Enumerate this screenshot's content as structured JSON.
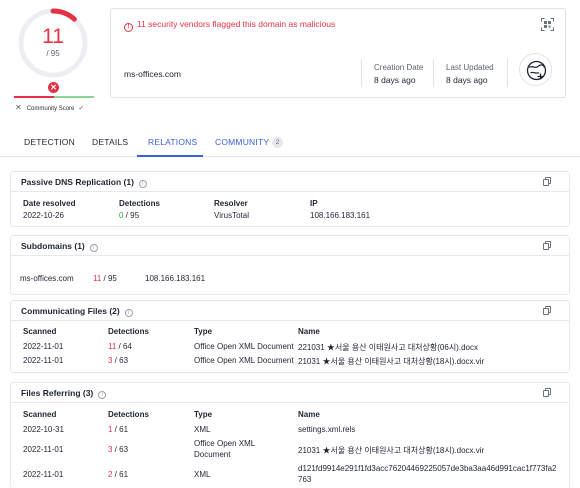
{
  "score": {
    "positives": "11",
    "total": "/ 95",
    "progress_fraction": 0.116
  },
  "community": {
    "label": "Community Score"
  },
  "summary": {
    "alert": "11 security vendors flagged this domain as malicious",
    "domain": "ms-offices.com",
    "creation_label": "Creation Date",
    "creation_value": "8 days ago",
    "updated_label": "Last Updated",
    "updated_value": "8 days ago"
  },
  "tabs": {
    "detection": "DETECTION",
    "details": "DETAILS",
    "relations": "RELATIONS",
    "community": "COMMUNITY",
    "community_count": "2"
  },
  "passive_dns": {
    "title": "Passive DNS Replication (1)",
    "headers": [
      "Date resolved",
      "Detections",
      "Resolver",
      "IP"
    ],
    "rows": [
      {
        "date": "2022-10-26",
        "det_pos": "0",
        "det_total": " / 95",
        "resolver": "VirusTotal",
        "ip": "108.166.183.161"
      }
    ]
  },
  "subdomains": {
    "title": "Subdomains (1)",
    "rows": [
      {
        "name": "ms-offices.com",
        "det_pos": "11",
        "det_total": " / 95",
        "ip": "108.166.183.161"
      }
    ]
  },
  "communicating": {
    "title": "Communicating Files (2)",
    "headers": [
      "Scanned",
      "Detections",
      "Type",
      "Name"
    ],
    "rows": [
      {
        "scanned": "2022-11-01",
        "det_pos": "11",
        "det_total": " / 64",
        "type": "Office Open XML Document",
        "name": "221031 ★서울 용산 이태원사고 대처상황(06시).docx"
      },
      {
        "scanned": "2022-11-01",
        "det_pos": "3",
        "det_total": " / 63",
        "type": "Office Open XML Document",
        "name": "21031 ★서울 용산 이태원사고 대처상황(18시).docx.vir"
      }
    ]
  },
  "referring": {
    "title": "Files Referring (3)",
    "headers": [
      "Scanned",
      "Detections",
      "Type",
      "Name"
    ],
    "rows": [
      {
        "scanned": "2022-10-31",
        "det_pos": "1",
        "det_total": " / 61",
        "type": "XML",
        "name": "settings.xml.rels"
      },
      {
        "scanned": "2022-11-01",
        "det_pos": "3",
        "det_total": " / 63",
        "type": "Office Open XML Document",
        "name": "21031 ★서울 용산 이태원사고 대처상황(18시).docx.vir"
      },
      {
        "scanned": "2022-11-01",
        "det_pos": "2",
        "det_total": " / 61",
        "type": "XML",
        "name": "d121fd9914e291f1fd3acc76204469225057de3ba3aa46d991cac1f773fa2763"
      }
    ]
  },
  "colors": {
    "malicious": "#e53247",
    "clean": "#2ea44f",
    "accent": "#3b62d8"
  },
  "icons": [
    "alert-icon",
    "qr-code-icon",
    "fingerprint-icon",
    "info-icon",
    "copy-icon",
    "close-icon",
    "check-icon"
  ]
}
